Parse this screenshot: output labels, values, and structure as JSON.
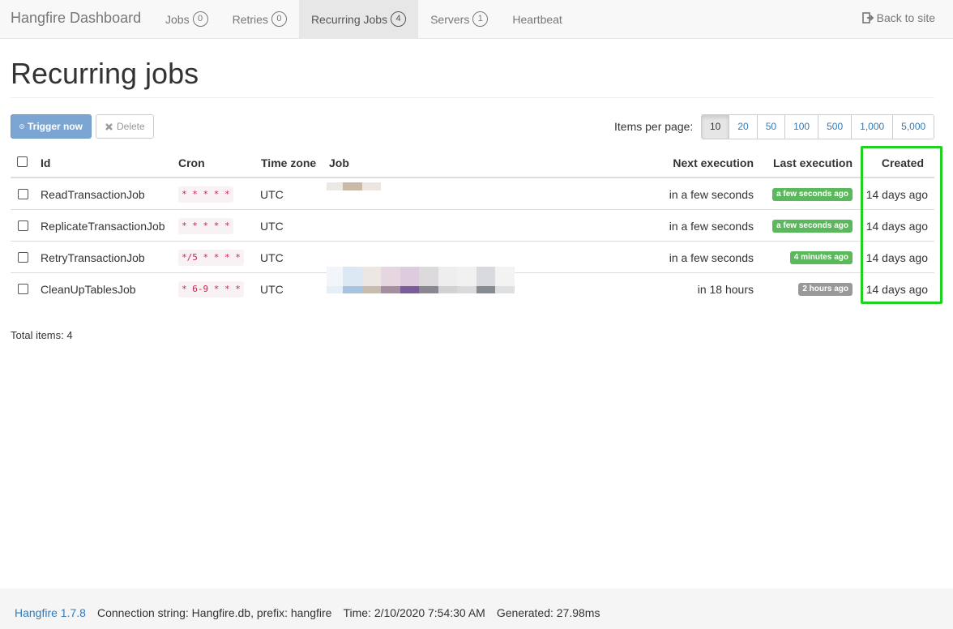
{
  "navbar": {
    "brand": "Hangfire Dashboard",
    "items": [
      {
        "label": "Jobs",
        "count": "0"
      },
      {
        "label": "Retries",
        "count": "0"
      },
      {
        "label": "Recurring Jobs",
        "count": "4"
      },
      {
        "label": "Servers",
        "count": "1"
      },
      {
        "label": "Heartbeat"
      }
    ],
    "back_label": "Back to site"
  },
  "page": {
    "title": "Recurring jobs"
  },
  "toolbar": {
    "trigger_label": "Trigger now",
    "delete_label": "Delete",
    "items_per_page_label": "Items per page:",
    "page_sizes": [
      "10",
      "20",
      "50",
      "100",
      "500",
      "1,000",
      "5,000"
    ],
    "selected_page_size": "10"
  },
  "table": {
    "headers": {
      "id": "Id",
      "cron": "Cron",
      "timezone": "Time zone",
      "job": "Job",
      "next": "Next execution",
      "last": "Last execution",
      "created": "Created"
    },
    "rows": [
      {
        "id": "ReadTransactionJob",
        "cron": "* * * * *",
        "timezone": "UTC",
        "next": "in a few seconds",
        "last": "a few seconds ago",
        "last_status": "success",
        "created": "14 days ago"
      },
      {
        "id": "ReplicateTransactionJob",
        "cron": "* * * * *",
        "timezone": "UTC",
        "next": "in a few seconds",
        "last": "a few seconds ago",
        "last_status": "success",
        "created": "14 days ago"
      },
      {
        "id": "RetryTransactionJob",
        "cron": "*/5 * * * *",
        "timezone": "UTC",
        "next": "in a few seconds",
        "last": "4 minutes ago",
        "last_status": "success",
        "created": "14 days ago"
      },
      {
        "id": "CleanUpTablesJob",
        "cron": "* 6-9 * * *",
        "timezone": "UTC",
        "next": "in 18 hours",
        "last": "2 hours ago",
        "last_status": "default",
        "created": "14 days ago"
      }
    ]
  },
  "total_items": "Total items: 4",
  "footer": {
    "version": "Hangfire 1.7.8",
    "connection": "Connection string: Hangfire.db, prefix: hangfire",
    "time": "Time: 2/10/2020 7:54:30 AM",
    "generated": "Generated: 27.98ms"
  },
  "colors": {
    "highlight": "#1fd21f",
    "success": "#5cb85c",
    "primary": "#7ba5d3",
    "link": "#337ab7"
  }
}
